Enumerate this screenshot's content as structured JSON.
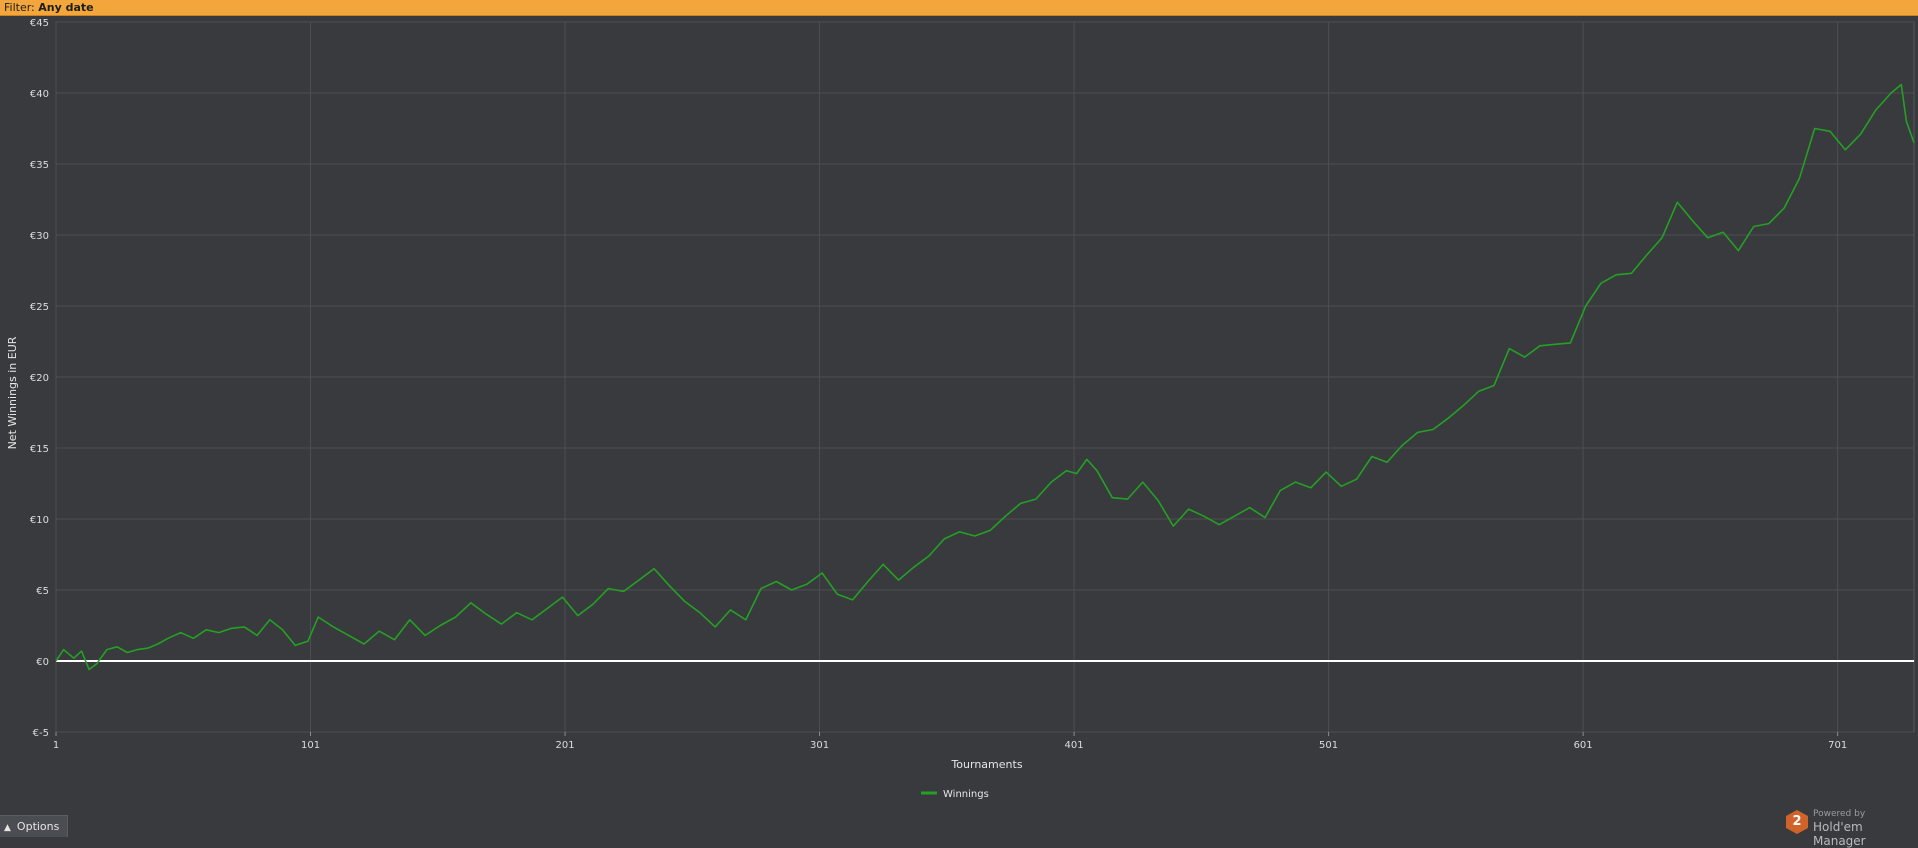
{
  "filter": {
    "label": "Filter:",
    "value": "Any date"
  },
  "options_label": "Options",
  "brand": {
    "powered": "Powered by",
    "product": "Hold'em Manager",
    "logo_text": "2"
  },
  "colors": {
    "background": "#383a3d",
    "grid": "#4c4f53",
    "series": "#24a024",
    "zero_line": "#ffffff",
    "filter_bar": "#f2a63c"
  },
  "chart_data": {
    "type": "line",
    "xlabel": "Tournaments",
    "ylabel": "Net Winnings in EUR",
    "xlim": [
      1,
      731
    ],
    "ylim": [
      -5,
      45
    ],
    "xticks": [
      1,
      101,
      201,
      301,
      401,
      501,
      601,
      701
    ],
    "yticks": [
      -5,
      0,
      5,
      10,
      15,
      20,
      25,
      30,
      35,
      40,
      45
    ],
    "ytick_labels": [
      "€-5",
      "€0",
      "€5",
      "€10",
      "€15",
      "€20",
      "€25",
      "€30",
      "€35",
      "€40",
      "€45"
    ],
    "grid": true,
    "legend_position": "bottom-center",
    "series": [
      {
        "name": "Winnings",
        "color": "#24a024",
        "x": [
          1,
          4,
          8,
          11,
          14,
          17,
          21,
          25,
          29,
          33,
          37,
          41,
          45,
          50,
          55,
          60,
          65,
          70,
          75,
          80,
          85,
          90,
          95,
          100,
          104,
          110,
          116,
          122,
          128,
          134,
          140,
          146,
          152,
          158,
          164,
          170,
          176,
          182,
          188,
          194,
          200,
          206,
          212,
          218,
          224,
          230,
          236,
          242,
          248,
          254,
          260,
          266,
          272,
          278,
          284,
          290,
          296,
          302,
          308,
          314,
          320,
          326,
          332,
          338,
          344,
          350,
          356,
          362,
          368,
          374,
          380,
          386,
          392,
          398,
          402,
          406,
          410,
          416,
          422,
          428,
          434,
          440,
          446,
          452,
          458,
          464,
          470,
          476,
          482,
          488,
          494,
          500,
          506,
          512,
          518,
          524,
          530,
          536,
          542,
          548,
          554,
          560,
          566,
          572,
          578,
          584,
          590,
          596,
          602,
          608,
          614,
          620,
          626,
          632,
          638,
          644,
          650,
          656,
          662,
          668,
          674,
          680,
          686,
          692,
          698,
          704,
          710,
          716,
          722,
          726,
          728,
          731
        ],
        "y": [
          0.0,
          0.8,
          0.2,
          0.7,
          -0.6,
          -0.2,
          0.8,
          1.0,
          0.6,
          0.8,
          0.9,
          1.2,
          1.6,
          2.0,
          1.6,
          2.2,
          2.0,
          2.3,
          2.4,
          1.8,
          2.9,
          2.2,
          1.1,
          1.4,
          3.1,
          2.4,
          1.8,
          1.2,
          2.1,
          1.5,
          2.9,
          1.8,
          2.5,
          3.1,
          4.1,
          3.3,
          2.6,
          3.4,
          2.9,
          3.7,
          4.5,
          3.2,
          4.0,
          5.1,
          4.9,
          5.7,
          6.5,
          5.3,
          4.2,
          3.4,
          2.4,
          3.6,
          2.9,
          5.1,
          5.6,
          5.0,
          5.4,
          6.2,
          4.7,
          4.3,
          5.6,
          6.8,
          5.7,
          6.6,
          7.4,
          8.6,
          9.1,
          8.8,
          9.2,
          10.2,
          11.1,
          11.4,
          12.6,
          13.4,
          13.2,
          14.2,
          13.4,
          11.5,
          11.4,
          12.6,
          11.3,
          9.5,
          10.7,
          10.2,
          9.6,
          10.2,
          10.8,
          10.1,
          12.0,
          12.6,
          12.2,
          13.3,
          12.3,
          12.8,
          14.4,
          14.0,
          15.2,
          16.1,
          16.3,
          17.1,
          18.0,
          19.0,
          19.4,
          22.0,
          21.4,
          22.2,
          22.3,
          22.4,
          25.0,
          26.6,
          27.2,
          27.3,
          28.6,
          29.8,
          32.3,
          31.0,
          29.8,
          30.2,
          28.9,
          30.6,
          30.8,
          31.9,
          34.0,
          37.5,
          37.3,
          36.0,
          37.1,
          38.8,
          40.0,
          40.6,
          38.0,
          36.5
        ]
      }
    ]
  }
}
